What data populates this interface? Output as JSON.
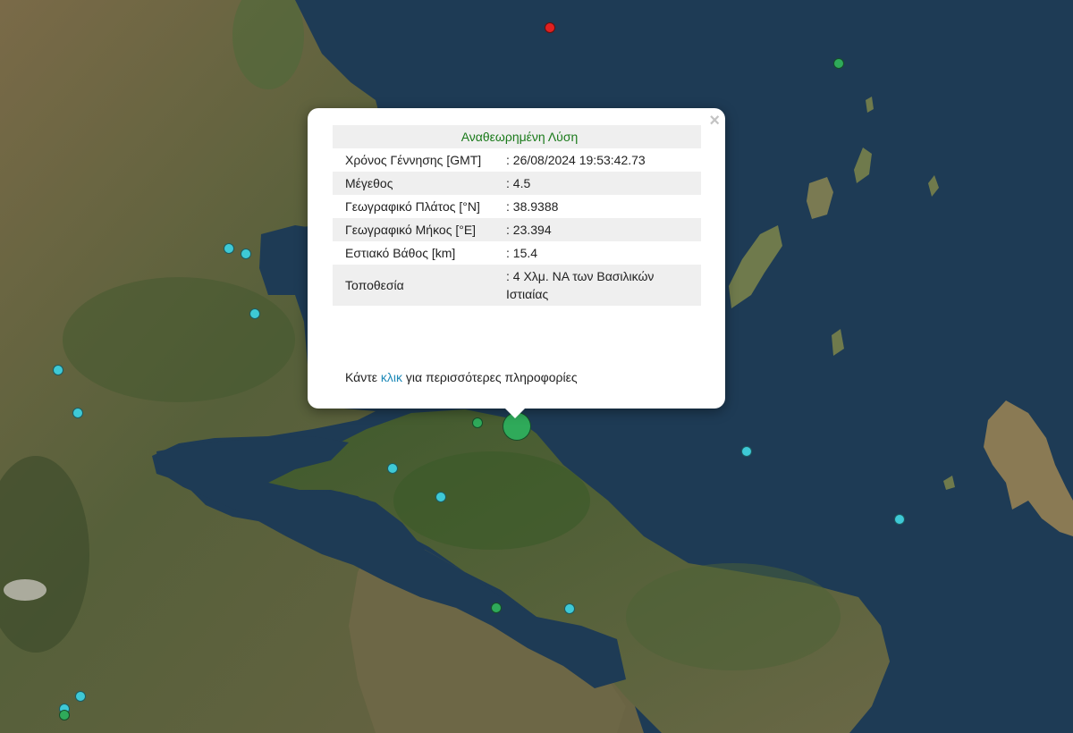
{
  "popup": {
    "close_label": "×",
    "title": "Αναθεωρημένη Λύση",
    "rows": [
      {
        "label": "Χρόνος Γέννησης [GMT]",
        "value": ": 26/08/2024 19:53:42.73"
      },
      {
        "label": "Μέγεθος",
        "value": ": 4.5"
      },
      {
        "label": "Γεωγραφικό Πλάτος [°N]",
        "value": ": 38.9388"
      },
      {
        "label": "Γεωγραφικό Μήκος [°E]",
        "value": ": 23.394"
      },
      {
        "label": "Εστιακό Βάθος [km]",
        "value": ": 15.4"
      },
      {
        "label": "Τοποθεσία",
        "value": ": 4 Χλμ. ΝΑ των Βασιλικών Ιστιαίας"
      }
    ],
    "more_prefix": "Κάντε ",
    "more_link": "κλικ",
    "more_suffix": " για περισσότερες πληροφορίες"
  },
  "colors": {
    "sea": "#1e3b55",
    "land": "#6e6440",
    "marker_cyan": "#3ec9d6",
    "marker_green": "#2faa5a",
    "marker_red": "#e02020",
    "popup_title": "#1a7a1a",
    "link": "#1f8ab8"
  }
}
